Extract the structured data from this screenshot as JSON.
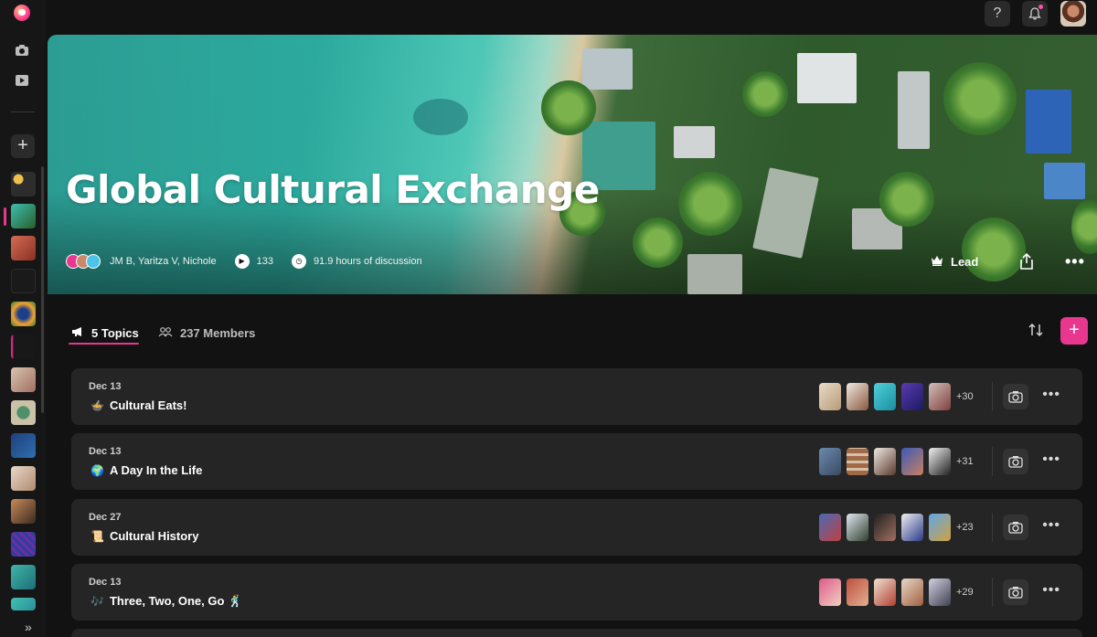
{
  "colors": {
    "accent": "#e8378f",
    "card_bg": "#252525",
    "page_bg": "#121212"
  },
  "topbar": {
    "help_icon": "question-icon",
    "notifications_icon": "bell-icon",
    "help_label": "?"
  },
  "sidebar": {
    "icons": [
      "camera-icon",
      "video-icon"
    ],
    "add_label": "+",
    "expand_label": "»"
  },
  "hero": {
    "title": "Global Cultural Exchange",
    "members_label": "JM B, Yaritza V, Nichole",
    "views_count": "133",
    "discussion_label": "91.9 hours of discussion",
    "lead_label": "Lead"
  },
  "tabs": [
    {
      "label": "5 Topics",
      "icon": "megaphone-icon"
    },
    {
      "label": "237 Members",
      "icon": "people-icon"
    }
  ],
  "add_label": "+",
  "topics": [
    {
      "date": "Dec 13",
      "emoji": "🍲",
      "title": "Cultural Eats!",
      "more": "+30"
    },
    {
      "date": "Dec 13",
      "emoji": "🌍",
      "title": "A Day In the Life",
      "more": "+31"
    },
    {
      "date": "Dec 27",
      "emoji": "📜",
      "title": "Cultural History",
      "more": "+23"
    },
    {
      "date": "Dec 13",
      "emoji": "🎶",
      "title": "Three, Two, One, Go 🕺",
      "more": "+29"
    }
  ]
}
